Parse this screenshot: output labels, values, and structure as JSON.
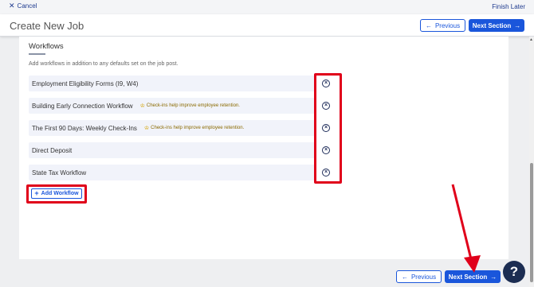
{
  "topbar": {
    "cancel_label": "Cancel",
    "finish_label": "Finish Later"
  },
  "header": {
    "title": "Create New Job",
    "previous_label": "Previous",
    "next_label": "Next Section"
  },
  "workflows": {
    "title": "Workflows",
    "description": "Add workflows in addition to any defaults set on the job post.",
    "items": [
      {
        "name": "Employment Eligibility Forms (I9, W4)",
        "hint": ""
      },
      {
        "name": "Building Early Connection Workflow",
        "hint": "Check-ins help improve employee retention."
      },
      {
        "name": "The First 90 Days: Weekly Check-Ins",
        "hint": "Check-ins help improve employee retention."
      },
      {
        "name": "Direct Deposit",
        "hint": ""
      },
      {
        "name": "State Tax Workflow",
        "hint": ""
      }
    ],
    "add_label": "Add Workflow"
  },
  "footer": {
    "previous_label": "Previous",
    "next_label": "Next Section"
  },
  "help_label": "?",
  "colors": {
    "accent": "#1a56db",
    "highlight": "#e0001a",
    "help_bg": "#1c2d52"
  }
}
